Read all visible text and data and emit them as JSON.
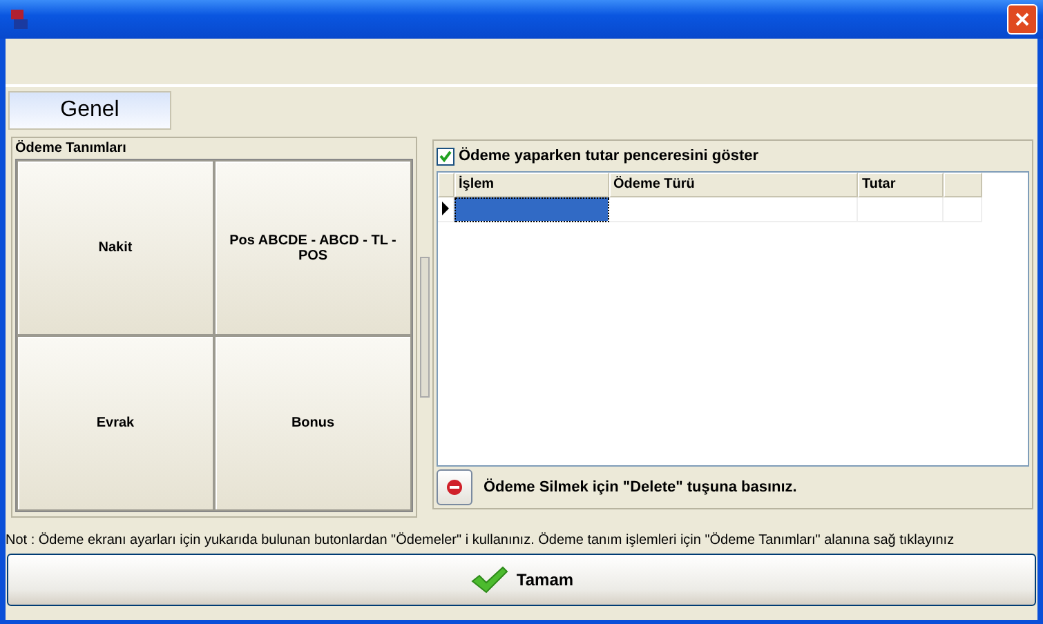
{
  "tabs": [
    {
      "label": "Genel",
      "selected": true
    }
  ],
  "payment_definitions": {
    "title": "Ödeme Tanımları",
    "buttons": [
      "Nakit",
      "Pos ABCDE - ABCD - TL - POS",
      "Evrak",
      "Bonus"
    ]
  },
  "show_amount_window": {
    "label": "Ödeme yaparken tutar penceresini göster",
    "checked": true
  },
  "grid": {
    "columns": [
      "İşlem",
      "Ödeme Türü",
      "Tutar"
    ],
    "rows": [
      {
        "selected": true
      }
    ]
  },
  "delete_hint": "Ödeme Silmek için \"Delete\" tuşuna basınız.",
  "note": "Not : Ödeme ekranı ayarları için yukarıda bulunan butonlardan \"Ödemeler\" i kullanınız. Ödeme tanım işlemleri için \"Ödeme Tanımları\" alanına sağ tıklayınız",
  "ok_button": "Tamam"
}
